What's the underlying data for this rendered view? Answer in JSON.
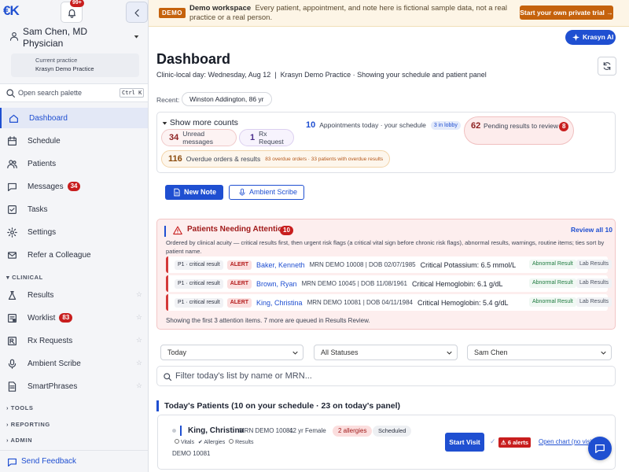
{
  "sidebar": {
    "logo": "€K",
    "notif_badge": "99+",
    "user_name": "Sam Chen, MD",
    "user_role": "Physician",
    "practice_label": "Current practice",
    "practice_name": "Krasyn Demo Practice",
    "search_placeholder": "Open search palette",
    "search_shortcut": "Ctrl K",
    "nav": [
      {
        "label": "Dashboard",
        "icon": "home-icon",
        "active": true
      },
      {
        "label": "Schedule",
        "icon": "calendar-icon"
      },
      {
        "label": "Patients",
        "icon": "users-icon"
      },
      {
        "label": "Messages",
        "icon": "message-icon",
        "badge": "34"
      },
      {
        "label": "Tasks",
        "icon": "checkbox-icon"
      },
      {
        "label": "Settings",
        "icon": "gear-icon"
      },
      {
        "label": "Refer a Colleague",
        "icon": "mail-icon"
      }
    ],
    "section_clinical": "CLINICAL",
    "clinical": [
      {
        "label": "Results",
        "icon": "flask-icon"
      },
      {
        "label": "Worklist",
        "icon": "worklist-icon",
        "badge": "83"
      },
      {
        "label": "Rx Requests",
        "icon": "rx-icon"
      },
      {
        "label": "Ambient Scribe",
        "icon": "mic-icon"
      },
      {
        "label": "SmartPhrases",
        "icon": "document-icon"
      }
    ],
    "section_tools": "TOOLS",
    "section_reporting": "REPORTING",
    "section_admin": "ADMIN",
    "feedback": "Send Feedback"
  },
  "banner": {
    "tag": "DEMO",
    "title": "Demo workspace",
    "text": "Every patient, appointment, and note here is fictional sample data, not a real practice or a real person.",
    "cta": "Start your own private trial →"
  },
  "ai_button": "Krasyn AI",
  "header": {
    "title": "Dashboard",
    "subtitle": "Clinic-local day: Wednesday, Aug 12  |  Krasyn Demo Practice · Showing your schedule and patient panel"
  },
  "recent": {
    "label": "Recent:",
    "chip": "Winston Addington, 86 yr"
  },
  "counts": {
    "toggle": "Show more counts",
    "unread_num": "34",
    "unread_label": "Unread messages",
    "rx_num": "1",
    "rx_label": "Rx Request",
    "appt_num": "10",
    "appt_label": "Appointments today · your schedule",
    "appt_pill": "3 in lobby",
    "pending_num": "62",
    "pending_label": "Pending results to review",
    "pending_badge": "8",
    "overdue_num": "116",
    "overdue_label": "Overdue orders & results",
    "overdue_detail": "83 overdue orders · 33 patients with overdue results"
  },
  "actions": {
    "new_note": "New Note",
    "ambient": "Ambient Scribe"
  },
  "attention": {
    "title": "Patients Needing Attention",
    "count": "10",
    "review_all": "Review all 10",
    "desc": "Ordered by clinical acuity — critical results first, then urgent risk flags (a critical vital sign before chronic risk flags), abnormal results, warnings, routine items; ties sort by patient name.",
    "rows": [
      {
        "priority": "P1 · critical result",
        "alert": "ALERT",
        "name": "Baker, Kenneth",
        "mrn": "MRN DEMO 10008 | DOB 02/07/1985",
        "finding": "Critical Potassium: 6.5 mmol/L",
        "tag1": "Abnormal Result",
        "tag2": "Lab Results"
      },
      {
        "priority": "P1 · critical result",
        "alert": "ALERT",
        "name": "Brown, Ryan",
        "mrn": "MRN DEMO 10045 | DOB 11/08/1961",
        "finding": "Critical Hemoglobin: 6.1 g/dL",
        "tag1": "Abnormal Result",
        "tag2": "Lab Results"
      },
      {
        "priority": "P1 · critical result",
        "alert": "ALERT",
        "name": "King, Christina",
        "mrn": "MRN DEMO 10081 | DOB 04/11/1984",
        "finding": "Critical Hemoglobin: 5.4 g/dL",
        "tag1": "Abnormal Result",
        "tag2": "Lab Results"
      }
    ],
    "footer": "Showing the first 3 attention items. 7 more are queued in Results Review."
  },
  "filters": {
    "date": "Today",
    "status": "All Statuses",
    "provider": "Sam Chen"
  },
  "list_filter_placeholder": "Filter today's list by name or MRN...",
  "today": {
    "title": "Today's Patients (10 on your schedule · 23 on today's panel)",
    "patient": {
      "name": "King, Christina",
      "mrn": "MRN DEMO 10081",
      "age": "42 yr Female",
      "allergies": "2 allergies",
      "status": "Scheduled",
      "check_vitals": "Vitals",
      "check_allergies": "Allergies",
      "check_results": "Results",
      "id": "DEMO 10081",
      "start": "Start Visit",
      "alerts": "6 alerts",
      "open_chart": "Open chart (no visit)"
    }
  },
  "colors": {
    "brand": "#1f4fd1",
    "critical": "#d43838",
    "banner": "#fdf5e6",
    "cta": "#c5620c"
  }
}
